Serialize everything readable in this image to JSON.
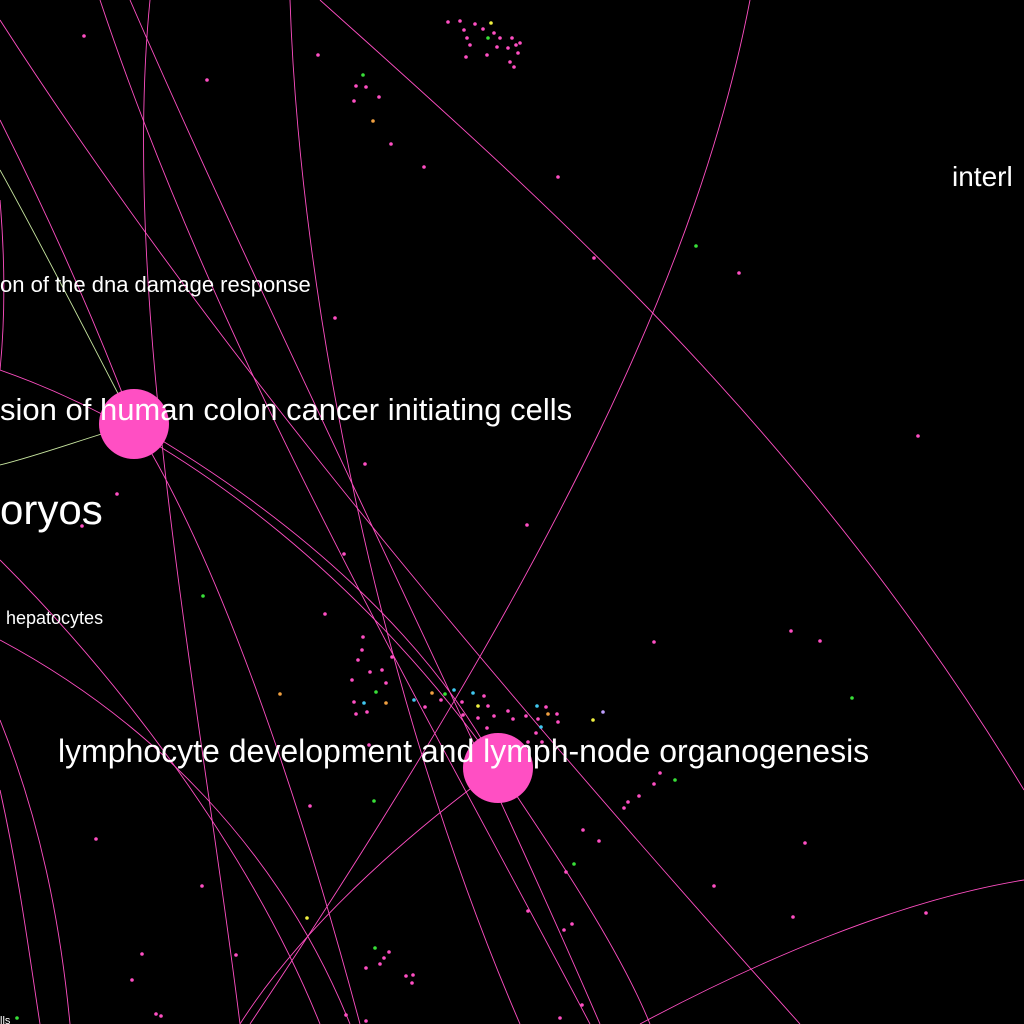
{
  "colors": {
    "background": "#000000",
    "primary_edge": "#ff4fc3",
    "secondary_edge": "#c8e6a0",
    "node": "#ff4fc3",
    "label": "#ffffff",
    "dot_palette": [
      "#ff4fc3",
      "#38e038",
      "#f0f040",
      "#40c8f0",
      "#f0a040",
      "#c0a0ff"
    ]
  },
  "labels": {
    "interl": "interl",
    "dna_damage": "on of the dna damage response",
    "colon_cancer": "sion of human colon cancer initiating cells",
    "embryos": "oryos",
    "hepatocytes": "hepatocytes",
    "lymphocyte": "lymphocyte development and lymph-node organogenesis",
    "cells_fragment": "lls"
  },
  "nodes": [
    {
      "id": "colon-cancer-node",
      "label_key": "colon_cancer"
    },
    {
      "id": "lymphocyte-node",
      "label_key": "lymphocyte"
    }
  ]
}
